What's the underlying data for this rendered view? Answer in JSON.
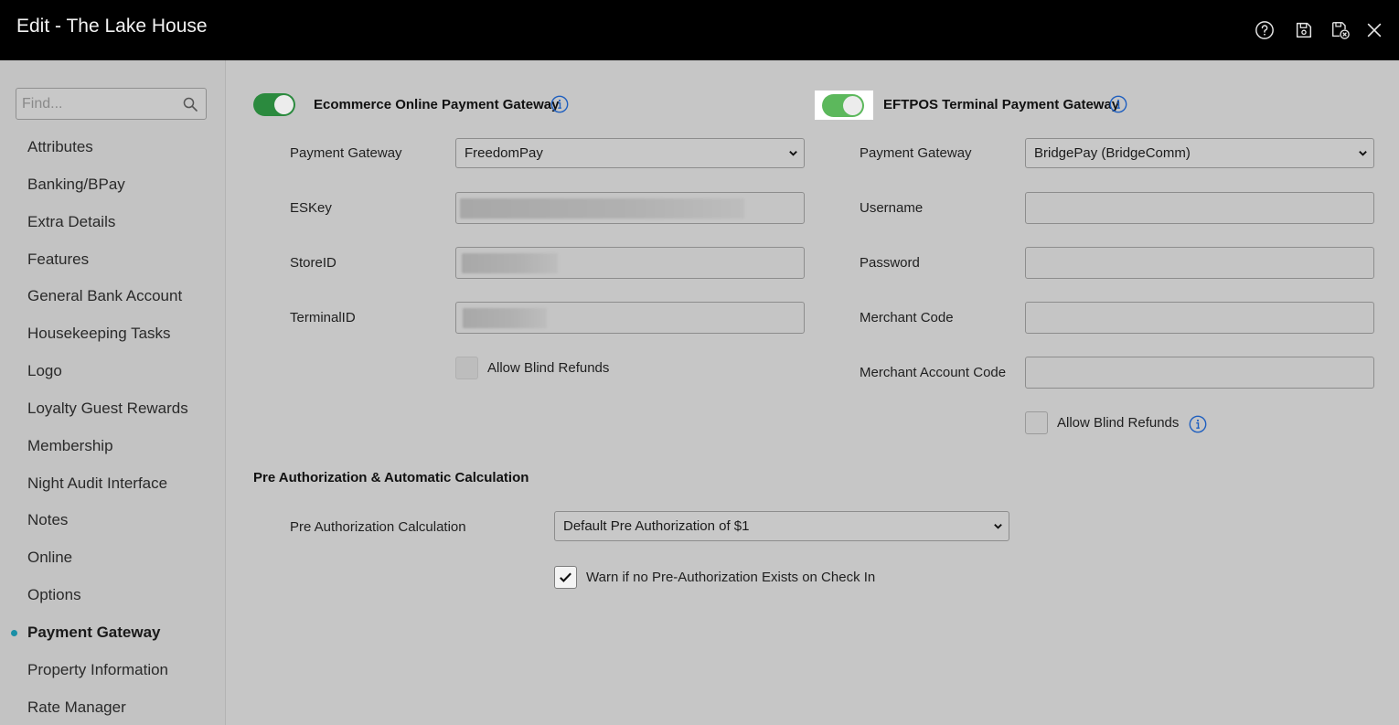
{
  "window": {
    "title": "Edit - The Lake House"
  },
  "titlebar_icons": [
    "help-icon",
    "save-icon",
    "save-close-icon",
    "close-icon"
  ],
  "sidebar": {
    "search_placeholder": "Find...",
    "items": [
      {
        "label": "Attributes"
      },
      {
        "label": "Banking/BPay"
      },
      {
        "label": "Extra Details"
      },
      {
        "label": "Features"
      },
      {
        "label": "General Bank Account"
      },
      {
        "label": "Housekeeping Tasks"
      },
      {
        "label": "Logo"
      },
      {
        "label": "Loyalty Guest Rewards"
      },
      {
        "label": "Membership"
      },
      {
        "label": "Night Audit Interface"
      },
      {
        "label": "Notes"
      },
      {
        "label": "Online"
      },
      {
        "label": "Options"
      },
      {
        "label": "Payment Gateway",
        "active": true
      },
      {
        "label": "Property Information"
      },
      {
        "label": "Rate Manager"
      }
    ]
  },
  "ecommerce": {
    "toggle_on": true,
    "title": "Ecommerce Online Payment Gateway",
    "gateway_label": "Payment Gateway",
    "gateway_value": "FreedomPay",
    "eskey_label": "ESKey",
    "storeid_label": "StoreID",
    "terminalid_label": "TerminalID",
    "blind_refunds_label": "Allow Blind Refunds",
    "blind_refunds_checked": false
  },
  "eftpos": {
    "toggle_on": true,
    "title": "EFTPOS Terminal Payment Gateway",
    "gateway_label": "Payment Gateway",
    "gateway_value": "BridgePay (BridgeComm)",
    "username_label": "Username",
    "password_label": "Password",
    "merchant_code_label": "Merchant Code",
    "merchant_account_label": "Merchant Account Code",
    "blind_refunds_label": "Allow Blind Refunds",
    "blind_refunds_checked": false
  },
  "preauth": {
    "title": "Pre Authorization & Automatic Calculation",
    "calc_label": "Pre Authorization Calculation",
    "calc_value": "Default Pre Authorization of $1",
    "warn_label": "Warn if no Pre-Authorization Exists on Check In",
    "warn_checked": true
  },
  "colors": {
    "accent": "#1a8fa6",
    "toggle_green": "#2b8a3e",
    "info_blue": "#1f5fbf"
  }
}
